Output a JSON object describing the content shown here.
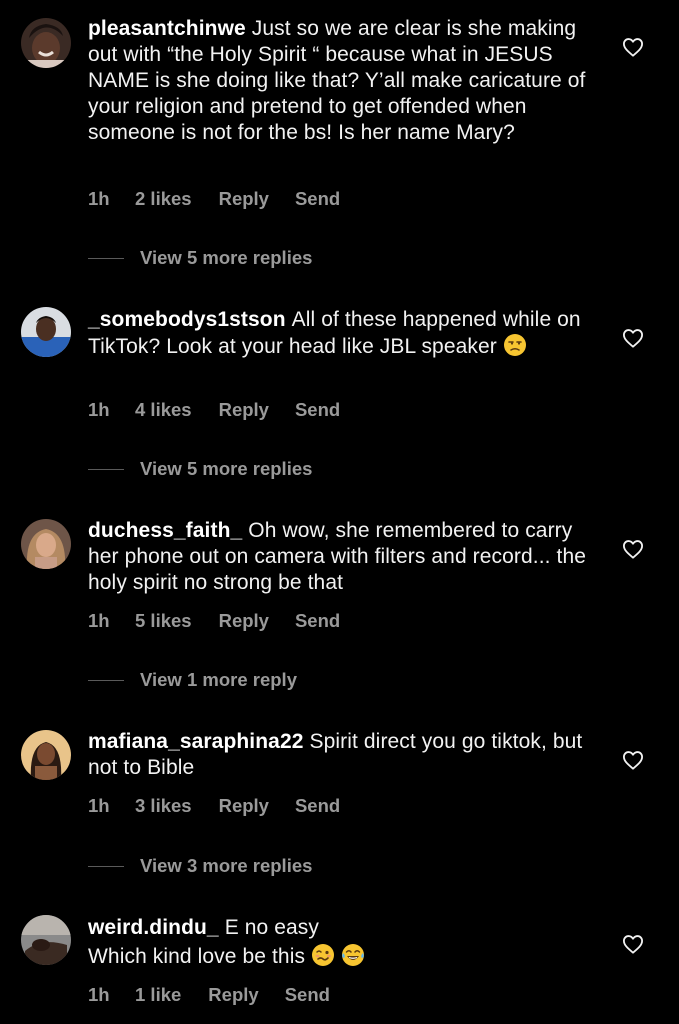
{
  "colors": {
    "background": "#000000",
    "text": "#f2f2f2",
    "meta": "#9a9a9a",
    "emoji": "#f7c531"
  },
  "comments": [
    {
      "username": "pleasantchinwe",
      "text": "Just so we are clear is she making out with “the Holy Spirit “ because what in JESUS NAME is she doing like that? Y’all make caricature of your religion and pretend to get offended when someone is not for the bs!  Is her name Mary?",
      "time": "1h",
      "likes": "2 likes",
      "reply": "Reply",
      "send": "Send",
      "view_more": "View 5 more replies"
    },
    {
      "username": "_somebodys1stson",
      "text": "All of these happened while on TikTok? Look at your head like JBL speaker",
      "emoji": [
        "unamused-face-icon"
      ],
      "time": "1h",
      "likes": "4 likes",
      "reply": "Reply",
      "send": "Send",
      "view_more": "View 5 more replies"
    },
    {
      "username": "duchess_faith_",
      "text": "Oh wow, she remembered to carry her phone out on camera with filters and record... the holy spirit no strong be that",
      "time": "1h",
      "likes": "5 likes",
      "reply": "Reply",
      "send": "Send",
      "view_more": "View 1 more reply"
    },
    {
      "username": "mafiana_saraphina22",
      "text": "Spirit direct you go tiktok, but not to Bible",
      "time": "1h",
      "likes": "3 likes",
      "reply": "Reply",
      "send": "Send",
      "view_more": "View 3 more replies"
    },
    {
      "username": "weird.dindu_",
      "text_line1": "E no easy",
      "text_line2": "Which kind love be this",
      "emoji": [
        "woozy-face-icon",
        "tears-of-joy-face-icon"
      ],
      "time": "1h",
      "likes": "1 like",
      "reply": "Reply",
      "send": "Send"
    }
  ]
}
